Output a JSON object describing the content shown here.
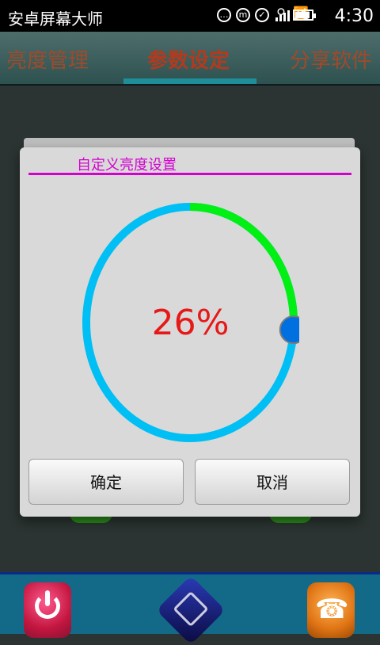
{
  "status_bar": {
    "app_title": "安卓屏幕大师",
    "network": "3G",
    "time": "4:30"
  },
  "tabs": [
    {
      "label": "亮度管理"
    },
    {
      "label": "参数设定"
    },
    {
      "label": "分享软件"
    }
  ],
  "dialog": {
    "title": "自定义亮度设置",
    "value_text": "26%",
    "value_fraction": 0.26,
    "confirm_label": "确定",
    "cancel_label": "取消"
  },
  "colors": {
    "track": "#00bff4",
    "progress": "#00f013",
    "thumb": "#0070e0",
    "value_text": "#e61818",
    "dialog_title": "#d400d0"
  },
  "bottom_bar": {
    "icons": [
      "power-icon",
      "diamond-app-icon",
      "phone-icon"
    ]
  }
}
